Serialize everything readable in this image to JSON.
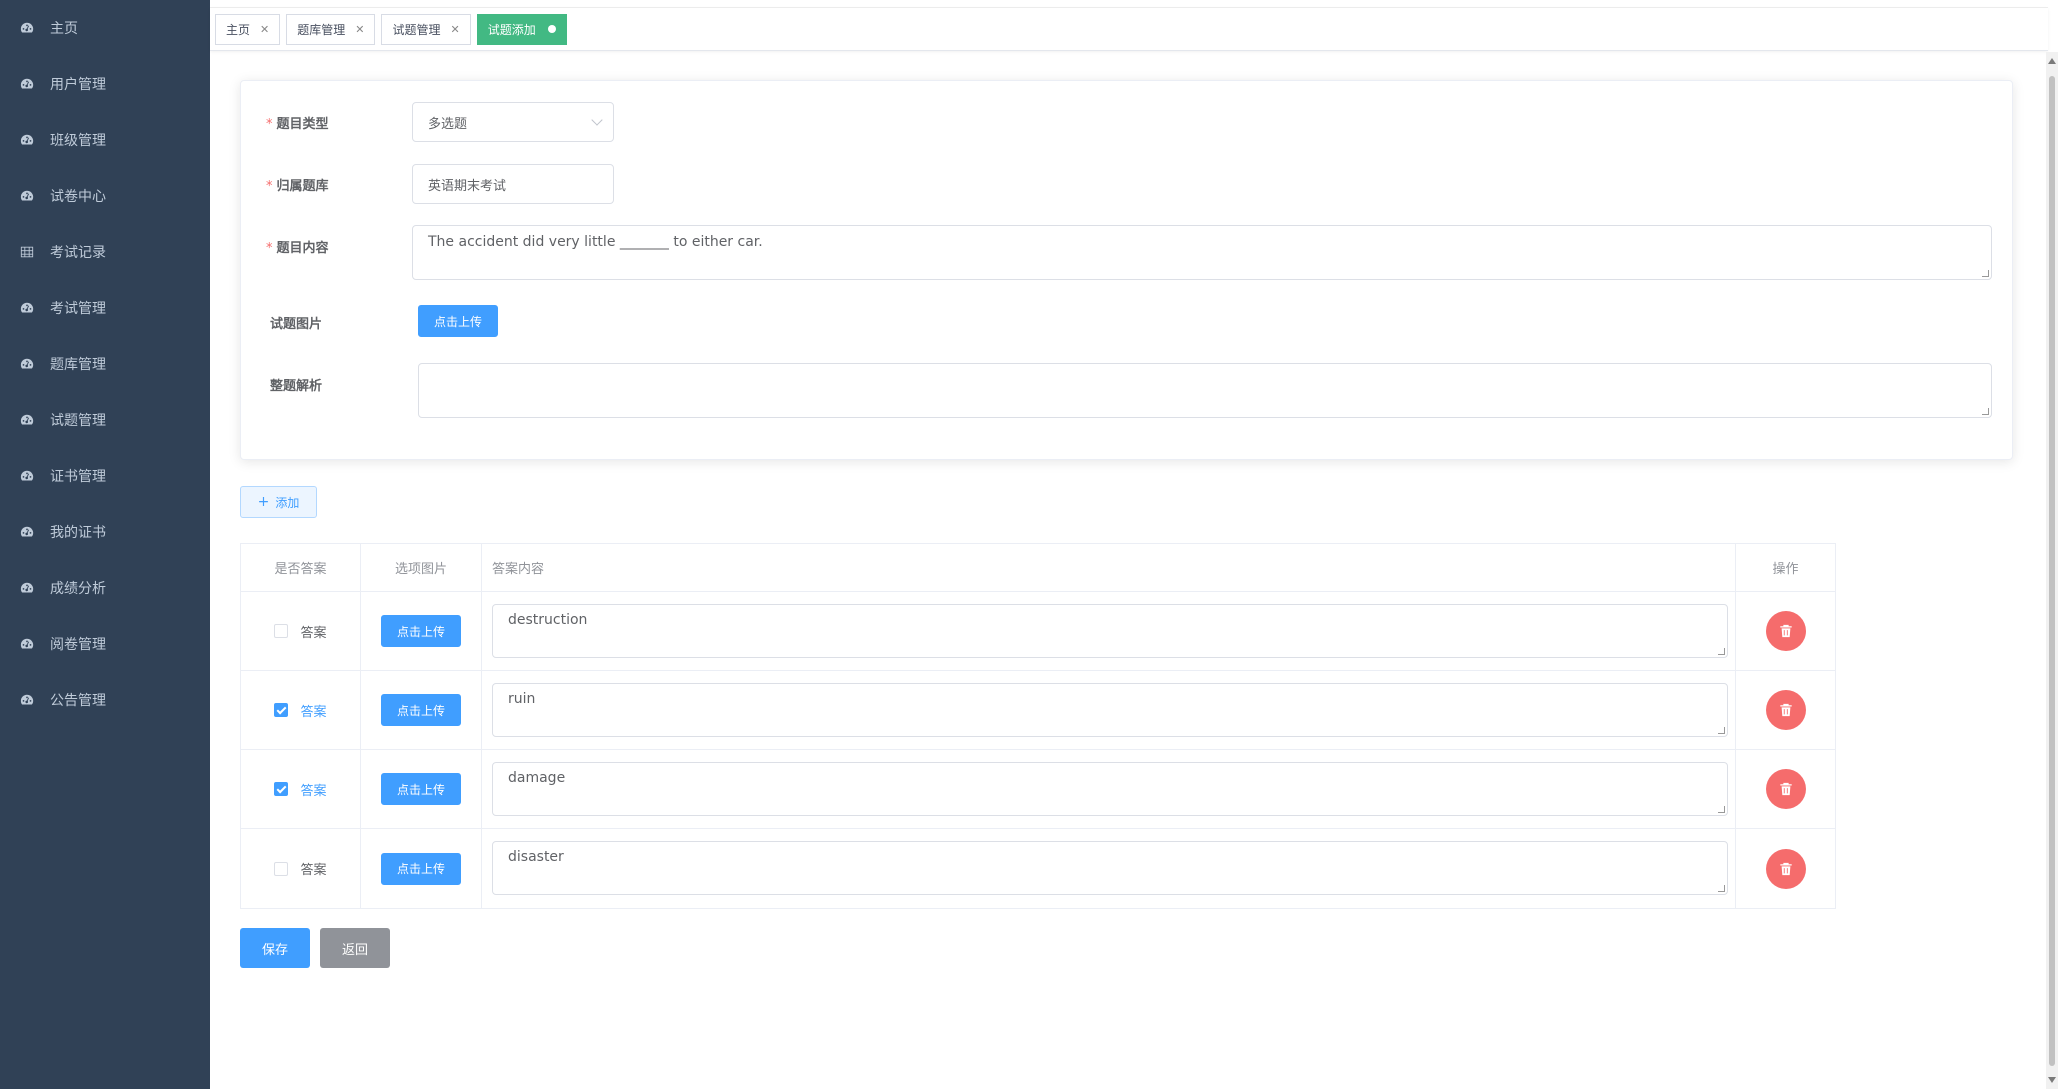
{
  "sidebar": {
    "items": [
      {
        "label": "主页",
        "icon": "dashboard-icon"
      },
      {
        "label": "用户管理",
        "icon": "dashboard-icon"
      },
      {
        "label": "班级管理",
        "icon": "dashboard-icon"
      },
      {
        "label": "试卷中心",
        "icon": "dashboard-icon"
      },
      {
        "label": "考试记录",
        "icon": "grid-icon"
      },
      {
        "label": "考试管理",
        "icon": "dashboard-icon"
      },
      {
        "label": "题库管理",
        "icon": "dashboard-icon"
      },
      {
        "label": "试题管理",
        "icon": "dashboard-icon"
      },
      {
        "label": "证书管理",
        "icon": "dashboard-icon"
      },
      {
        "label": "我的证书",
        "icon": "dashboard-icon"
      },
      {
        "label": "成绩分析",
        "icon": "dashboard-icon"
      },
      {
        "label": "阅卷管理",
        "icon": "dashboard-icon"
      },
      {
        "label": "公告管理",
        "icon": "dashboard-icon"
      }
    ]
  },
  "tags": [
    {
      "label": "主页",
      "active": false
    },
    {
      "label": "题库管理",
      "active": false
    },
    {
      "label": "试题管理",
      "active": false
    },
    {
      "label": "试题添加",
      "active": true
    }
  ],
  "form": {
    "type_label": "题目类型",
    "type_value": "多选题",
    "bank_label": "归属题库",
    "bank_value": "英语期末考试",
    "content_label": "题目内容",
    "content_value": "The accident did very little _______ to either car.",
    "image_label": "试题图片",
    "upload_label": "点击上传",
    "analysis_label": "整题解析",
    "analysis_value": ""
  },
  "add_button": "添加",
  "table": {
    "headers": {
      "is_answer": "是否答案",
      "option_image": "选项图片",
      "answer_content": "答案内容",
      "actions": "操作"
    },
    "checkbox_label": "答案",
    "upload_label": "点击上传",
    "rows": [
      {
        "checked": false,
        "content": "destruction"
      },
      {
        "checked": true,
        "content": "ruin"
      },
      {
        "checked": true,
        "content": "damage"
      },
      {
        "checked": false,
        "content": "disaster"
      }
    ]
  },
  "buttons": {
    "save": "保存",
    "back": "返回"
  },
  "colors": {
    "sidebar_bg": "#304156",
    "primary": "#409eff",
    "danger": "#f56c6c",
    "active_tag": "#42b983",
    "info": "#909399"
  }
}
